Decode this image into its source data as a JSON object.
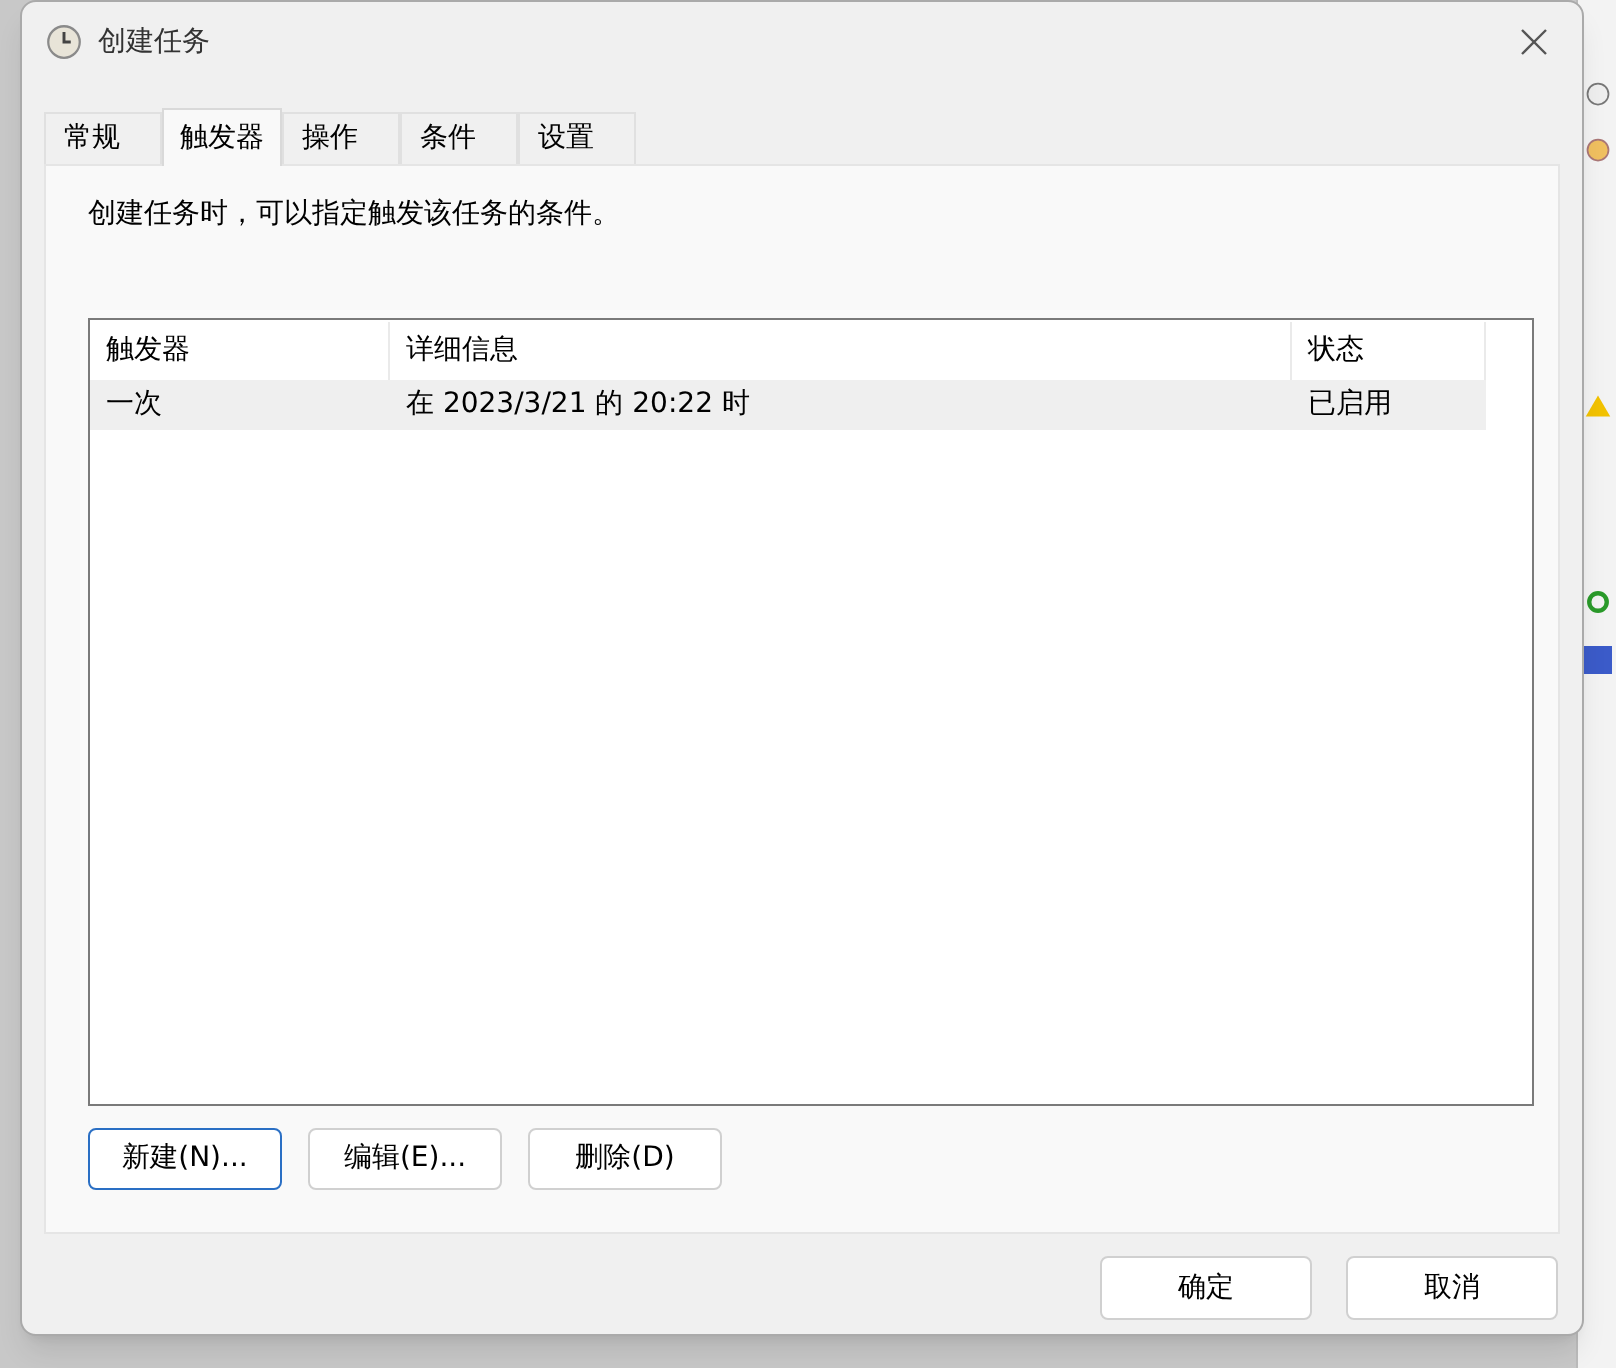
{
  "window": {
    "title": "创建任务"
  },
  "tabs": [
    {
      "label": "常规",
      "selected": false
    },
    {
      "label": "触发器",
      "selected": true
    },
    {
      "label": "操作",
      "selected": false
    },
    {
      "label": "条件",
      "selected": false
    },
    {
      "label": "设置",
      "selected": false
    }
  ],
  "description": "创建任务时，可以指定触发该任务的条件。",
  "table": {
    "columns": [
      "触发器",
      "详细信息",
      "状态"
    ],
    "rows": [
      {
        "cells": [
          "一次",
          "在 2023/3/21 的 20:22 时",
          "已启用"
        ],
        "selected": true
      }
    ]
  },
  "list_buttons": [
    {
      "label": "新建(N)...",
      "focused": true
    },
    {
      "label": "编辑(E)...",
      "focused": false
    },
    {
      "label": "删除(D)",
      "focused": false
    }
  ],
  "footer_buttons": [
    "确定",
    "取消"
  ]
}
